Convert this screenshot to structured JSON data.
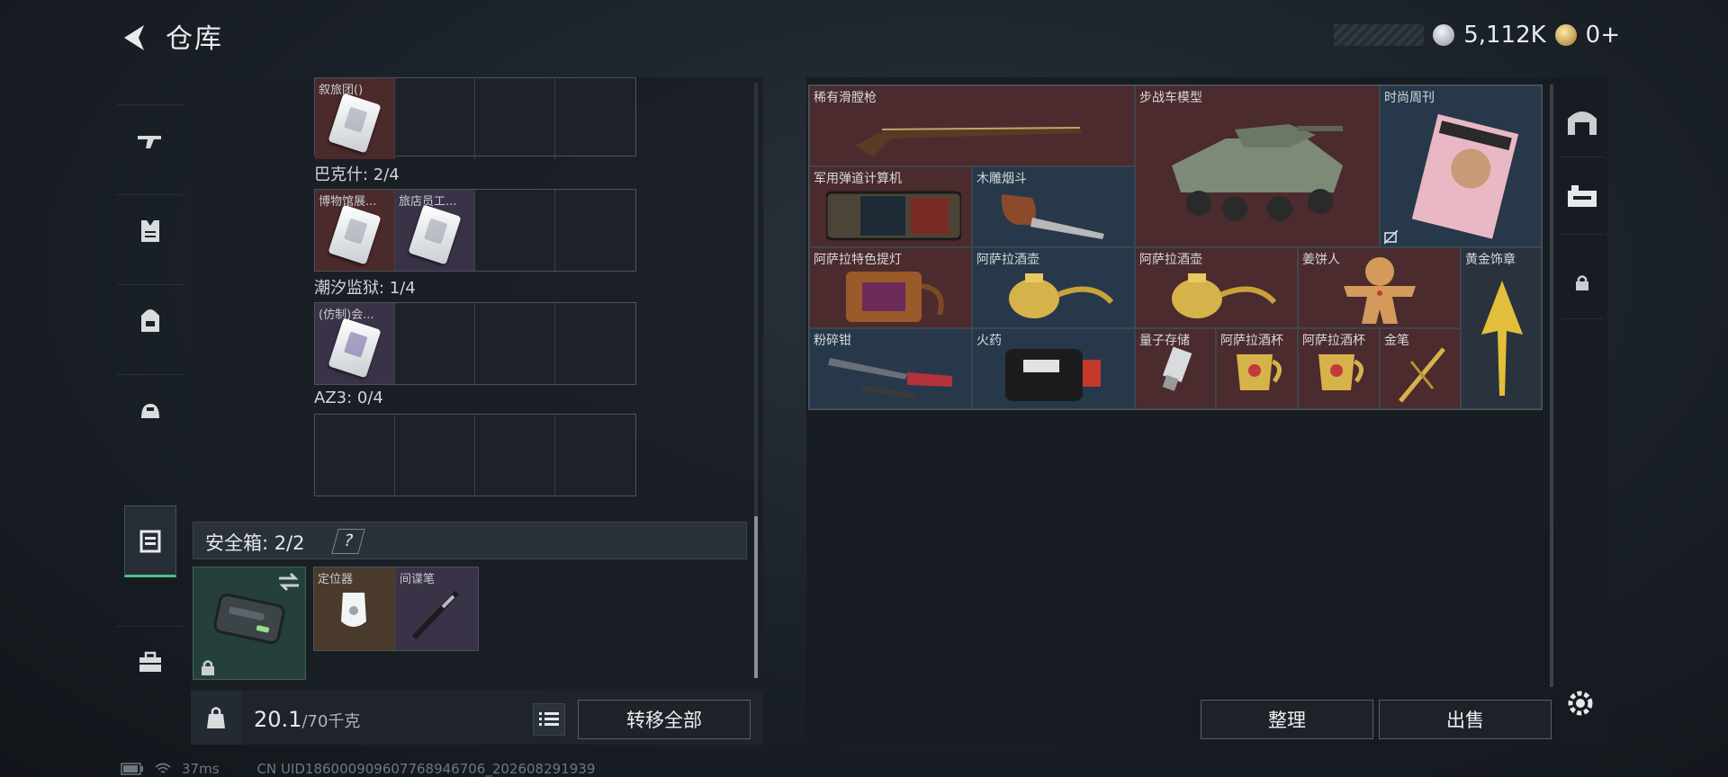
{
  "header": {
    "title": "仓库",
    "currency_silver": "5,112K",
    "currency_gold": "0+"
  },
  "left_nav": {
    "items": [
      "gun-icon",
      "vest-icon",
      "backpack-icon",
      "helmet-bag-icon",
      "safebox-icon",
      "toolbox-icon"
    ],
    "active_index": 4
  },
  "storage_groups": [
    {
      "label": "",
      "slots": [
        {
          "name": "叙旅团()",
          "color": "red",
          "icon": "keycard"
        },
        {},
        {},
        {}
      ]
    },
    {
      "label": "巴克什: 2/4",
      "slots": [
        {
          "name": "博物馆展...",
          "color": "red",
          "icon": "keycard"
        },
        {
          "name": "旅店员工...",
          "color": "purple",
          "icon": "keycard"
        },
        {},
        {}
      ]
    },
    {
      "label": "潮汐监狱: 1/4",
      "slots": [
        {
          "name": "(仿制)会...",
          "color": "purple",
          "icon": "keycard-alt"
        },
        {},
        {},
        {}
      ]
    },
    {
      "label": "AZ3: 0/4",
      "slots": [
        {},
        {},
        {},
        {}
      ]
    }
  ],
  "safebox": {
    "label": "安全箱: 2/2",
    "help": "?",
    "items": [
      {
        "name": "定位器",
        "icon": "locator"
      },
      {
        "name": "间谍笔",
        "icon": "spy-pen"
      }
    ]
  },
  "weight": {
    "current": "20.1",
    "max": "/70千克"
  },
  "buttons": {
    "transfer_all": "转移全部",
    "sort": "整理",
    "sell": "出售"
  },
  "grid_items": [
    {
      "name": "稀有滑膛枪",
      "color": "red"
    },
    {
      "name": "步战车模型",
      "color": "red"
    },
    {
      "name": "时尚周刊",
      "color": "blue"
    },
    {
      "name": "军用弹道计算机",
      "color": "red"
    },
    {
      "name": "木雕烟斗",
      "color": "blue"
    },
    {
      "name": "阿萨拉特色提灯",
      "color": "red"
    },
    {
      "name": "阿萨拉酒壶",
      "color": "blue"
    },
    {
      "name": "阿萨拉酒壶",
      "color": "red"
    },
    {
      "name": "姜饼人",
      "color": "red"
    },
    {
      "name": "黄金饰章",
      "color": "dark"
    },
    {
      "name": "粉碎钳",
      "color": "blue"
    },
    {
      "name": "火药",
      "color": "blue"
    },
    {
      "name": "量子存储",
      "color": "red"
    },
    {
      "name": "阿萨拉酒杯",
      "color": "red"
    },
    {
      "name": "阿萨拉酒杯",
      "color": "red"
    },
    {
      "name": "金笔",
      "color": "red"
    },
    {
      "name": "",
      "color": "dark"
    }
  ],
  "status": {
    "ping": "37ms",
    "uid": "CN UID186000909607768946706_202608291939"
  }
}
